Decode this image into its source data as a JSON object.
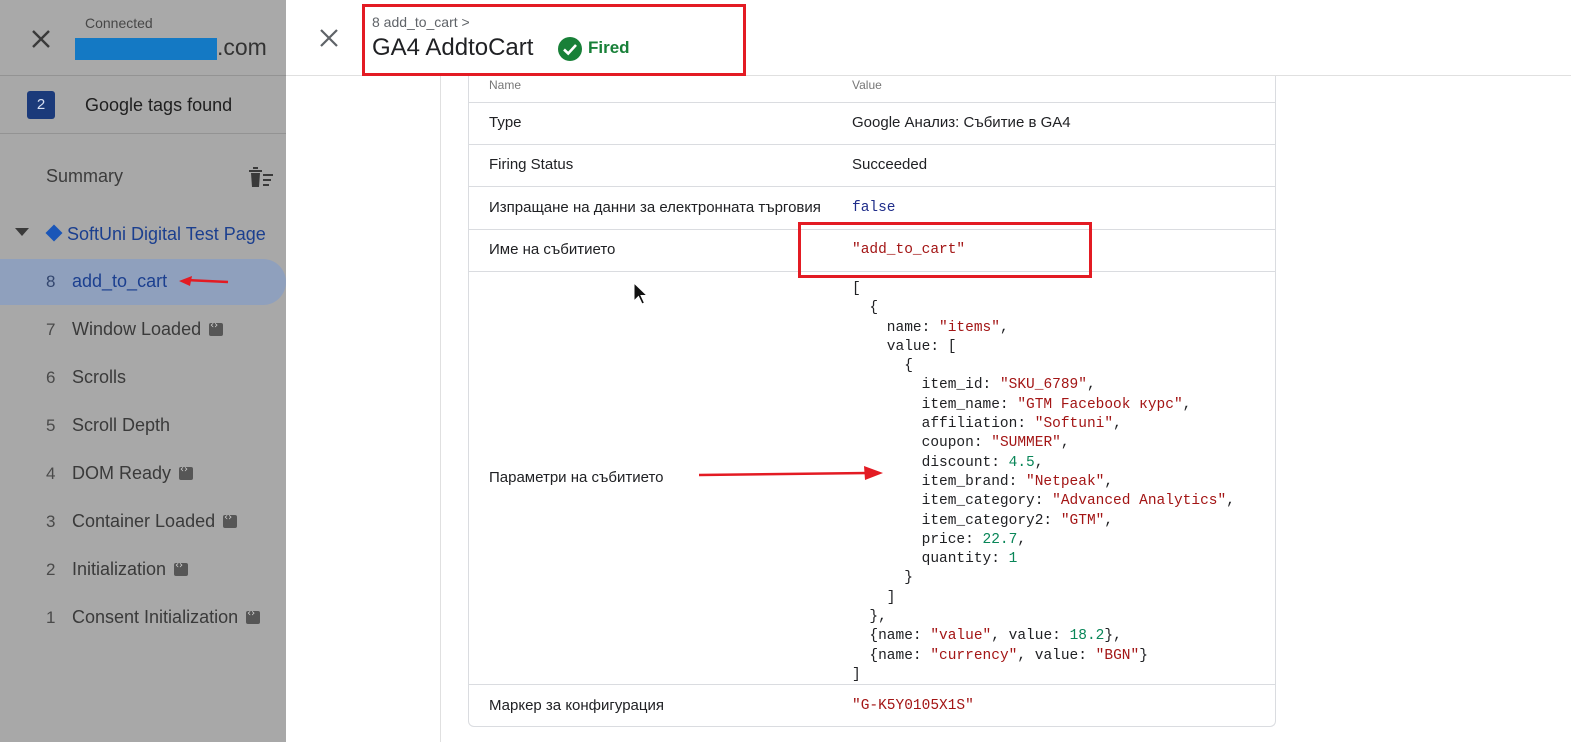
{
  "sidebar": {
    "close_icon": "close-icon",
    "connection_status": "Connected",
    "domain_suffix": ".com",
    "tags_found_count": "2",
    "tags_found_label": "Google tags found",
    "summary_label": "Summary",
    "container_name": "SoftUni Digital Test Page",
    "events": [
      {
        "num": "8",
        "label": "add_to_cart",
        "selected": true
      },
      {
        "num": "7",
        "label": "Window Loaded",
        "code": true
      },
      {
        "num": "6",
        "label": "Scrolls"
      },
      {
        "num": "5",
        "label": "Scroll Depth"
      },
      {
        "num": "4",
        "label": "DOM Ready",
        "code": true
      },
      {
        "num": "3",
        "label": "Container Loaded",
        "code": true
      },
      {
        "num": "2",
        "label": "Initialization",
        "code": true
      },
      {
        "num": "1",
        "label": "Consent Initialization",
        "code": true
      }
    ]
  },
  "panel": {
    "breadcrumb": "8 add_to_cart >",
    "title": "GA4 AddtoCart",
    "status": "Fired",
    "status_color": "#188038",
    "table": {
      "col_name": "Name",
      "col_value": "Value",
      "rows": [
        {
          "name": "Type",
          "value": "Google Анализ: Събитие в GA4"
        },
        {
          "name": "Firing Status",
          "value": "Succeeded"
        },
        {
          "name": "Изпращане на данни за електронната търговия",
          "value": "false"
        },
        {
          "name": "Име на събитието",
          "value": "\"add_to_cart\""
        },
        {
          "name": "Параметри на събитието",
          "value": "event_params"
        },
        {
          "name": "Маркер за конфигурация",
          "value": "\"G-K5Y0105X1S\""
        }
      ]
    },
    "event_params": {
      "items": [
        {
          "item_id": "SKU_6789",
          "item_name": "GTM Facebook курс",
          "affiliation": "Softuni",
          "coupon": "SUMMER",
          "discount": "4.5",
          "item_brand": "Netpeak",
          "item_category": "Advanced Analytics",
          "item_category2": "GTM",
          "price": "22.7",
          "quantity": "1"
        }
      ],
      "value": "18.2",
      "currency": "BGN"
    }
  },
  "annotation_color": "#e31b23"
}
